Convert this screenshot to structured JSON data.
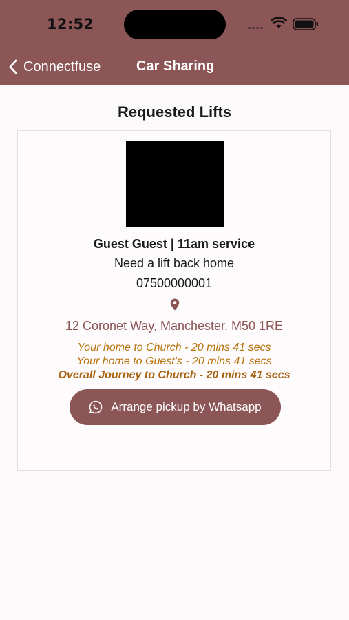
{
  "status_bar": {
    "time": "12:52"
  },
  "nav": {
    "back_label": "Connectfuse",
    "title": "Car Sharing"
  },
  "page": {
    "title": "Requested Lifts"
  },
  "lift_request": {
    "guest": "Guest Guest | 11am service",
    "note": "Need a lift back home",
    "phone": "07500000001",
    "address": "12 Coronet Way, Manchester. M50 1RE",
    "journey_home_to_church": "Your home to Church - 20 mins 41 secs",
    "journey_home_to_guest": "Your home to Guest's - 20 mins 41 secs",
    "journey_overall": "Overall Journey to Church - 20 mins 41 secs",
    "whatsapp_button": "Arrange pickup by Whatsapp"
  },
  "colors": {
    "brand": "#8c5556",
    "journey_text": "#b8720c",
    "background": "#fcf9fb"
  },
  "icons": {
    "back": "chevron-left-icon",
    "pin": "map-pin-icon",
    "whatsapp": "whatsapp-icon",
    "wifi": "wifi-icon",
    "battery": "battery-icon",
    "signal": "cellular-signal-icon"
  }
}
